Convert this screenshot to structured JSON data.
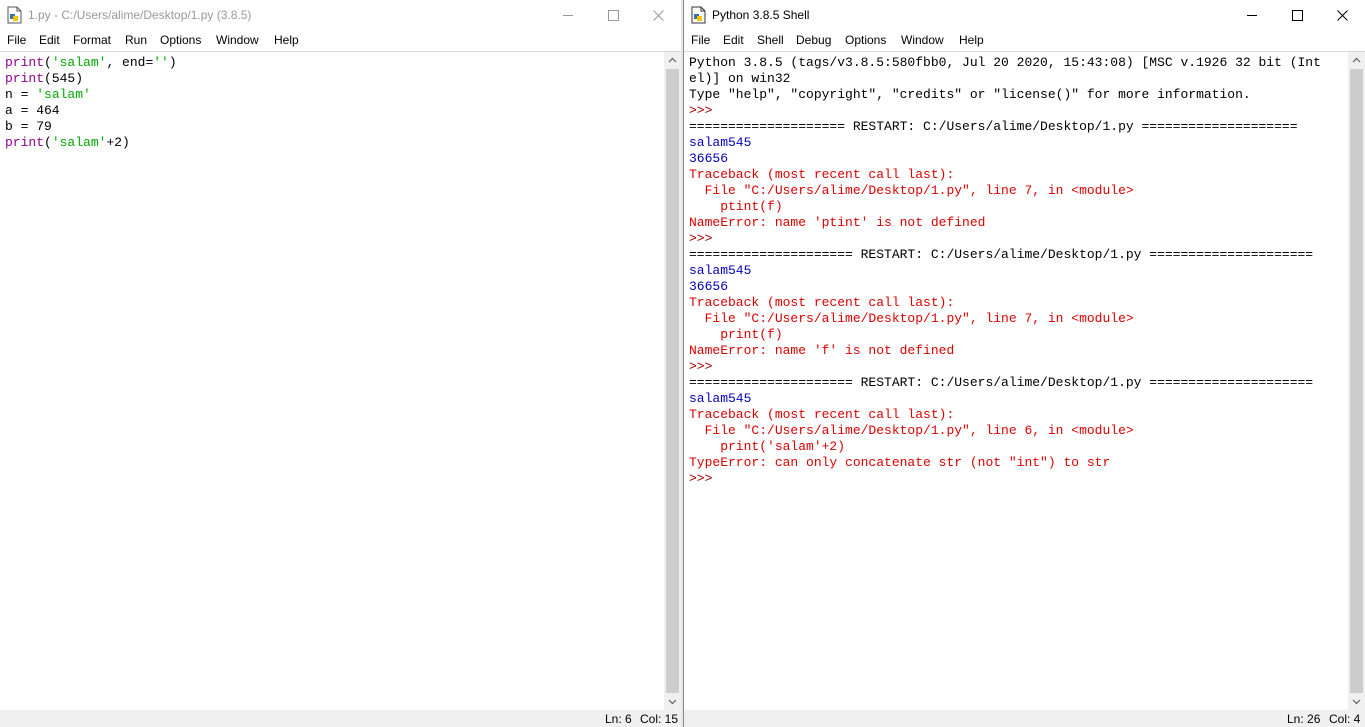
{
  "editor": {
    "title": "1.py - C:/Users/alime/Desktop/1.py (3.8.5)",
    "menu": [
      "File",
      "Edit",
      "Format",
      "Run",
      "Options",
      "Window",
      "Help"
    ],
    "code": [
      [
        [
          "print",
          "kw"
        ],
        [
          "(",
          ""
        ],
        [
          "'salam'",
          "str"
        ],
        [
          ", end=",
          ""
        ],
        [
          "''",
          "str"
        ],
        [
          ")",
          ""
        ]
      ],
      [
        [
          "print",
          "kw"
        ],
        [
          "(545)",
          ""
        ]
      ],
      [
        [
          "n = ",
          ""
        ],
        [
          "'salam'",
          "str"
        ]
      ],
      [
        [
          "a = 464",
          ""
        ]
      ],
      [
        [
          "b = 79",
          ""
        ]
      ],
      [
        [
          "print",
          "kw"
        ],
        [
          "(",
          ""
        ],
        [
          "'salam'",
          "str"
        ],
        [
          "+2)",
          ""
        ]
      ]
    ],
    "status": {
      "line": "Ln: 6",
      "col": "Col: 15"
    }
  },
  "shell": {
    "title": "Python 3.8.5 Shell",
    "menu": [
      "File",
      "Edit",
      "Shell",
      "Debug",
      "Options",
      "Window",
      "Help"
    ],
    "lines": [
      [
        [
          "Python 3.8.5 (tags/v3.8.5:580fbb0, Jul 20 2020, 15:43:08) [MSC v.1926 32 bit (Int",
          ""
        ]
      ],
      [
        [
          "el)] on win32",
          ""
        ]
      ],
      [
        [
          "Type \"help\", \"copyright\", \"credits\" or \"license()\" for more information.",
          ""
        ]
      ],
      [
        [
          ">>> ",
          "prm"
        ]
      ],
      [
        [
          "==================== RESTART: C:/Users/alime/Desktop/1.py ====================",
          ""
        ]
      ],
      [
        [
          "salam545",
          "out"
        ]
      ],
      [
        [
          "36656",
          "out"
        ]
      ],
      [
        [
          "Traceback (most recent call last):",
          "err"
        ]
      ],
      [
        [
          "  File \"C:/Users/alime/Desktop/1.py\", line 7, in <module>",
          "err"
        ]
      ],
      [
        [
          "    ptint(f)",
          "err"
        ]
      ],
      [
        [
          "NameError: name 'ptint' is not defined",
          "err"
        ]
      ],
      [
        [
          ">>> ",
          "prm"
        ]
      ],
      [
        [
          "===================== RESTART: C:/Users/alime/Desktop/1.py =====================",
          ""
        ]
      ],
      [
        [
          "salam545",
          "out"
        ]
      ],
      [
        [
          "36656",
          "out"
        ]
      ],
      [
        [
          "Traceback (most recent call last):",
          "err"
        ]
      ],
      [
        [
          "  File \"C:/Users/alime/Desktop/1.py\", line 7, in <module>",
          "err"
        ]
      ],
      [
        [
          "    print(f)",
          "err"
        ]
      ],
      [
        [
          "NameError: name 'f' is not defined",
          "err"
        ]
      ],
      [
        [
          ">>> ",
          "prm"
        ]
      ],
      [
        [
          "===================== RESTART: C:/Users/alime/Desktop/1.py =====================",
          ""
        ]
      ],
      [
        [
          "salam545",
          "out"
        ]
      ],
      [
        [
          "Traceback (most recent call last):",
          "err"
        ]
      ],
      [
        [
          "  File \"C:/Users/alime/Desktop/1.py\", line 6, in <module>",
          "err"
        ]
      ],
      [
        [
          "    print('salam'+2)",
          "err"
        ]
      ],
      [
        [
          "TypeError: can only concatenate str (not \"int\") to str",
          "err"
        ]
      ],
      [
        [
          ">>> ",
          "prm"
        ]
      ]
    ],
    "status": {
      "line": "Ln: 26",
      "col": "Col: 4"
    }
  },
  "icons": {
    "app": "idle-python-file-icon",
    "minimize": "minimize-icon",
    "maximize": "maximize-icon",
    "close": "close-icon"
  },
  "colors": {
    "keyword": "#900090",
    "string": "#00aa00",
    "stdout": "#0000c0",
    "stderr": "#dd0000",
    "prompt": "#a40000"
  }
}
